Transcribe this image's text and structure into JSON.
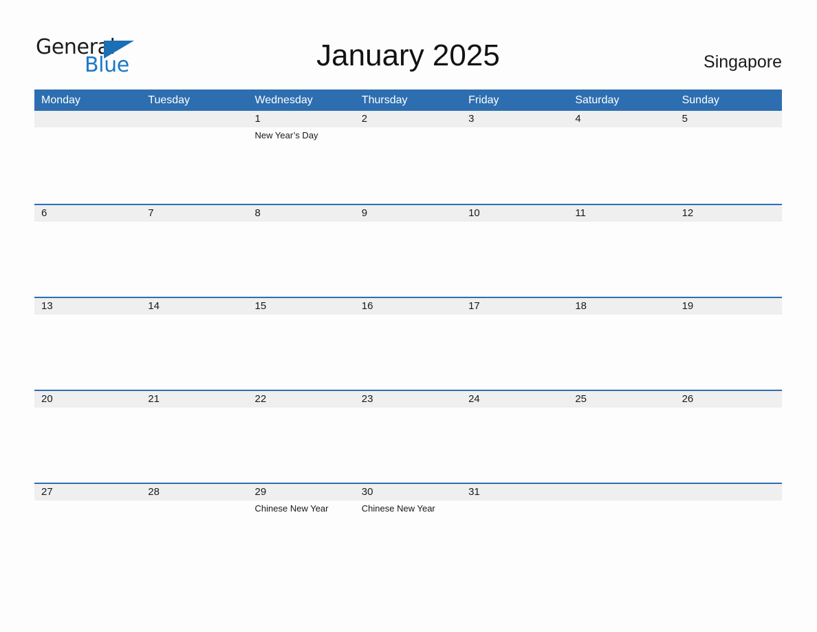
{
  "logo": {
    "part1": "General",
    "part2": "Blue",
    "triangle_color": "#1a6fb5",
    "text_color": "#1c1c1c",
    "blue_text_color": "#1a78c8"
  },
  "header": {
    "title": "January 2025",
    "region": "Singapore"
  },
  "theme": {
    "accent": "#2d6eb0",
    "band": "#efefef",
    "background": "#fdfdfd",
    "header_text": "#ffffff"
  },
  "calendar": {
    "weekdays": [
      "Monday",
      "Tuesday",
      "Wednesday",
      "Thursday",
      "Friday",
      "Saturday",
      "Sunday"
    ],
    "weeks": [
      [
        {
          "day": "",
          "events": []
        },
        {
          "day": "",
          "events": []
        },
        {
          "day": "1",
          "events": [
            "New Year’s Day"
          ]
        },
        {
          "day": "2",
          "events": []
        },
        {
          "day": "3",
          "events": []
        },
        {
          "day": "4",
          "events": []
        },
        {
          "day": "5",
          "events": []
        }
      ],
      [
        {
          "day": "6",
          "events": []
        },
        {
          "day": "7",
          "events": []
        },
        {
          "day": "8",
          "events": []
        },
        {
          "day": "9",
          "events": []
        },
        {
          "day": "10",
          "events": []
        },
        {
          "day": "11",
          "events": []
        },
        {
          "day": "12",
          "events": []
        }
      ],
      [
        {
          "day": "13",
          "events": []
        },
        {
          "day": "14",
          "events": []
        },
        {
          "day": "15",
          "events": []
        },
        {
          "day": "16",
          "events": []
        },
        {
          "day": "17",
          "events": []
        },
        {
          "day": "18",
          "events": []
        },
        {
          "day": "19",
          "events": []
        }
      ],
      [
        {
          "day": "20",
          "events": []
        },
        {
          "day": "21",
          "events": []
        },
        {
          "day": "22",
          "events": []
        },
        {
          "day": "23",
          "events": []
        },
        {
          "day": "24",
          "events": []
        },
        {
          "day": "25",
          "events": []
        },
        {
          "day": "26",
          "events": []
        }
      ],
      [
        {
          "day": "27",
          "events": []
        },
        {
          "day": "28",
          "events": []
        },
        {
          "day": "29",
          "events": [
            "Chinese New Year"
          ]
        },
        {
          "day": "30",
          "events": [
            "Chinese New Year"
          ]
        },
        {
          "day": "31",
          "events": []
        },
        {
          "day": "",
          "events": []
        },
        {
          "day": "",
          "events": []
        }
      ]
    ]
  }
}
